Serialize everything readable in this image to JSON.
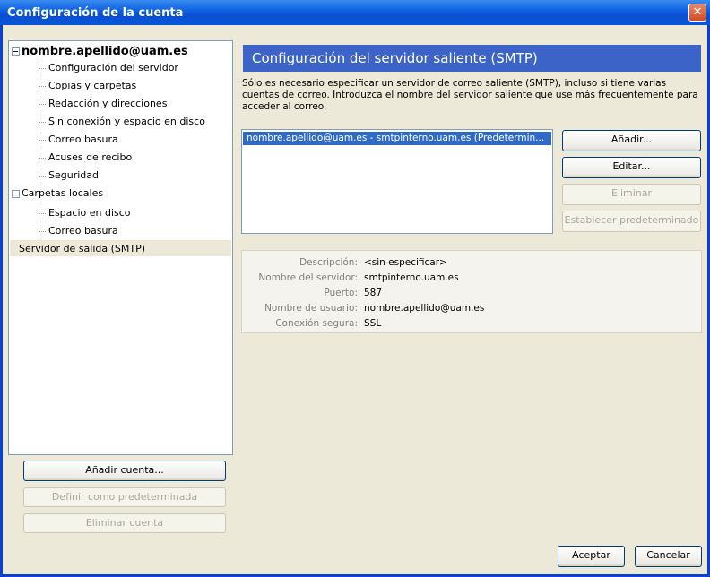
{
  "window": {
    "title": "Configuración de la cuenta",
    "close_glyph": "✕"
  },
  "tree": {
    "account": "nombre.apellido@uam.es",
    "account_items": [
      "Configuración del servidor",
      "Copias y carpetas",
      "Redacción y direcciones",
      "Sin conexión y espacio en disco",
      "Correo basura",
      "Acuses de recibo",
      "Seguridad"
    ],
    "local_folders": "Carpetas locales",
    "local_items": [
      "Espacio en disco",
      "Correo basura"
    ],
    "smtp_item": "Servidor de salida (SMTP)",
    "expander_glyph": "−"
  },
  "left_buttons": {
    "add_account": "Añadir cuenta...",
    "set_default": "Definir como predeterminada",
    "delete_account": "Eliminar cuenta"
  },
  "smtp": {
    "header": "Configuración del servidor saliente (SMTP)",
    "description": "Sólo es necesario especificar un servidor de correo saliente (SMTP), incluso si tiene varias cuentas de correo. Introduzca el nombre del servidor saliente que use más frecuentemente para acceder al correo.",
    "servers": [
      "nombre.apellido@uam.es - smtpinterno.uam.es (Predetermin..."
    ],
    "buttons": {
      "add": "Añadir...",
      "edit": "Editar...",
      "delete": "Eliminar",
      "set_default": "Establecer predeterminado"
    },
    "details": [
      {
        "label": "Descripción:",
        "value": "<sin especificar>"
      },
      {
        "label": "Nombre del servidor:",
        "value": "smtpinterno.uam.es"
      },
      {
        "label": "Puerto:",
        "value": "587"
      },
      {
        "label": "Nombre de usuario:",
        "value": "nombre.apellido@uam.es"
      },
      {
        "label": "Conexión segura:",
        "value": "SSL"
      }
    ]
  },
  "footer": {
    "ok": "Aceptar",
    "cancel": "Cancelar"
  },
  "colors": {
    "titlebar": "#0b5ee0",
    "selection": "#316ac5",
    "header": "#3c64c8",
    "dialog_bg": "#ece9d8"
  }
}
